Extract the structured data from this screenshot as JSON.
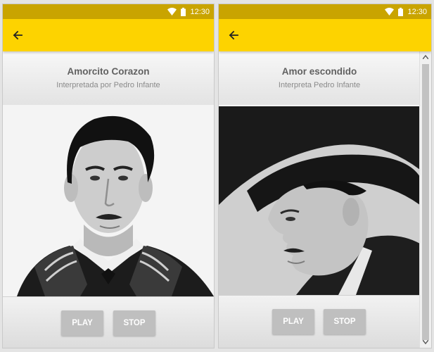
{
  "status_bar": {
    "time": "12:30"
  },
  "left_screen": {
    "title": "Amorcito Corazon",
    "subtitle": "Interpretada por Pedro Infante",
    "photo_alt": "",
    "play_label": "PLAY",
    "stop_label": "STOP"
  },
  "right_screen": {
    "title": "Amor escondido",
    "subtitle": "Interpreta Pedro Infante",
    "play_label": "PLAY",
    "stop_label": "STOP"
  },
  "colors": {
    "app_bar": "#fdd300",
    "status_bar": "#c9a400",
    "button": "#bfbfbf"
  },
  "icons": {
    "back": "arrow-left-icon",
    "wifi": "wifi-icon",
    "battery": "battery-icon"
  }
}
